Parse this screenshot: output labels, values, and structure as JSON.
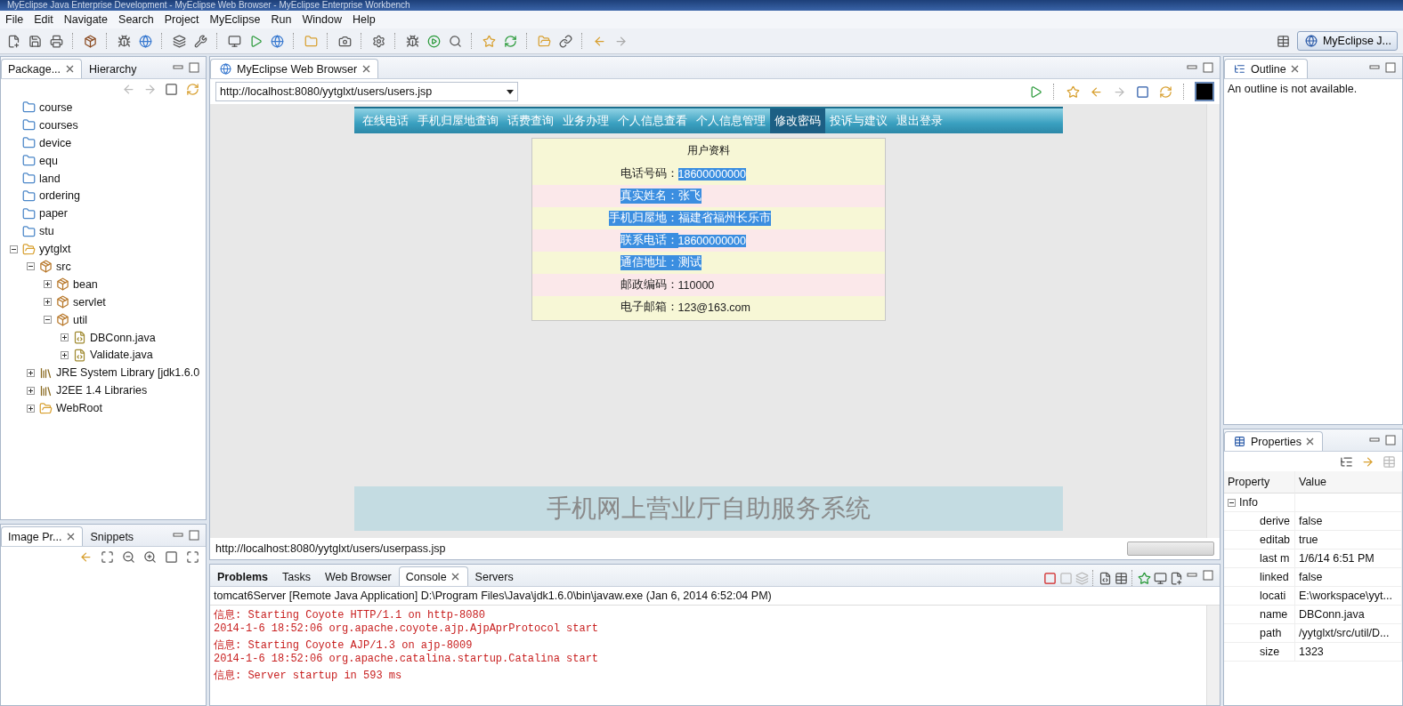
{
  "window": {
    "title": "MyEclipse Java Enterprise Development - MyEclipse Web Browser - MyEclipse Enterprise Workbench"
  },
  "menu": [
    "File",
    "Edit",
    "Navigate",
    "Search",
    "Project",
    "MyEclipse",
    "Run",
    "Window",
    "Help"
  ],
  "perspective": {
    "label": "MyEclipse J..."
  },
  "package_explorer": {
    "tabs": [
      {
        "label": "Package...",
        "selected": true
      },
      {
        "label": "Hierarchy",
        "selected": false
      }
    ],
    "tree": [
      {
        "label": "course",
        "kind": "folder"
      },
      {
        "label": "courses",
        "kind": "folder"
      },
      {
        "label": "device",
        "kind": "folder"
      },
      {
        "label": "equ",
        "kind": "folder"
      },
      {
        "label": "land",
        "kind": "folder"
      },
      {
        "label": "ordering",
        "kind": "folder"
      },
      {
        "label": "paper",
        "kind": "folder"
      },
      {
        "label": "stu",
        "kind": "folder"
      },
      {
        "label": "yytglxt",
        "kind": "project",
        "expanded": true,
        "children": [
          {
            "label": "src",
            "kind": "source",
            "expanded": true,
            "children": [
              {
                "label": "bean",
                "kind": "package",
                "expanded": false
              },
              {
                "label": "servlet",
                "kind": "package",
                "expanded": false
              },
              {
                "label": "util",
                "kind": "package",
                "expanded": true,
                "children": [
                  {
                    "label": "DBConn.java",
                    "kind": "java",
                    "expanded": false
                  },
                  {
                    "label": "Validate.java",
                    "kind": "java",
                    "expanded": false
                  }
                ]
              }
            ]
          },
          {
            "label": "JRE System Library [jdk1.6.0",
            "kind": "library",
            "expanded": false
          },
          {
            "label": "J2EE 1.4 Libraries",
            "kind": "library",
            "expanded": false
          },
          {
            "label": "WebRoot",
            "kind": "webfolder",
            "expanded": false
          }
        ]
      }
    ]
  },
  "image_preview": {
    "tabs": [
      {
        "label": "Image Pr...",
        "selected": true
      },
      {
        "label": "Snippets",
        "selected": false
      }
    ]
  },
  "browser": {
    "tab": "MyEclipse Web Browser",
    "url": "http://localhost:8080/yytglxt/users/users.jsp",
    "status": "http://localhost:8080/yytglxt/users/userpass.jsp",
    "page": {
      "nav": [
        {
          "label": "在线电话",
          "selected": false
        },
        {
          "label": "手机归屋地查询",
          "selected": false
        },
        {
          "label": "话费查询",
          "selected": false
        },
        {
          "label": "业务办理",
          "selected": false
        },
        {
          "label": "个人信息查看",
          "selected": false
        },
        {
          "label": "个人信息管理",
          "selected": false
        },
        {
          "label": "修改密码",
          "selected": true
        },
        {
          "label": "投诉与建议",
          "selected": false
        },
        {
          "label": "退出登录",
          "selected": false
        }
      ],
      "form_title": "用户资料",
      "fields": [
        {
          "label": {
            "text": "电话号码：",
            "selected": false
          },
          "value": {
            "text": "18600000000",
            "selected": true
          }
        },
        {
          "label": {
            "text": "真实姓名：",
            "selected": true
          },
          "value": {
            "text": "张飞",
            "selected": true
          }
        },
        {
          "label": {
            "text": "手机归屋地：",
            "selected": true
          },
          "value": {
            "text": "福建省福州长乐市",
            "selected": true
          }
        },
        {
          "label": {
            "text": "联系电话：",
            "selected": true
          },
          "value": {
            "text": "18600000000",
            "selected": true
          }
        },
        {
          "label": {
            "text": "通信地址：",
            "selected": true
          },
          "value": {
            "text": "测试",
            "selected": true
          }
        },
        {
          "label": {
            "text": "邮政编码：",
            "selected": false
          },
          "value": {
            "text": "110000",
            "selected": false
          }
        },
        {
          "label": {
            "text": "电子邮箱：",
            "selected": false
          },
          "value": {
            "text": "123@163.com",
            "selected": false
          }
        }
      ],
      "footer": "手机网上营业厅自助服务系统"
    }
  },
  "console": {
    "tabs": [
      {
        "label": "Problems",
        "selected": false,
        "bold": true
      },
      {
        "label": "Tasks",
        "selected": false,
        "bold": false
      },
      {
        "label": "Web Browser",
        "selected": false,
        "bold": false
      },
      {
        "label": "Console",
        "selected": true,
        "bold": false
      },
      {
        "label": "Servers",
        "selected": false,
        "bold": false
      }
    ],
    "process": "tomcat6Server [Remote Java Application] D:\\Program Files\\Java\\jdk1.6.0\\bin\\javaw.exe (Jan 6, 2014 6:52:04 PM)",
    "lines": [
      "信息: Starting Coyote HTTP/1.1 on http-8080",
      "2014-1-6 18:52:06 org.apache.coyote.ajp.AjpAprProtocol start",
      "信息: Starting Coyote AJP/1.3 on ajp-8009",
      "2014-1-6 18:52:06 org.apache.catalina.startup.Catalina start",
      "信息: Server startup in 593 ms"
    ]
  },
  "outline": {
    "tab": "Outline",
    "message": "An outline is not available."
  },
  "properties": {
    "tab": "Properties",
    "columns": [
      "Property",
      "Value"
    ],
    "group": {
      "label": "Info",
      "expanded": true
    },
    "rows": [
      {
        "name": "derive",
        "value": "false"
      },
      {
        "name": "editab",
        "value": "true"
      },
      {
        "name": "last m",
        "value": "1/6/14 6:51 PM"
      },
      {
        "name": "linked",
        "value": "false"
      },
      {
        "name": "locati",
        "value": "E:\\workspace\\yyt..."
      },
      {
        "name": "name",
        "value": "DBConn.java"
      },
      {
        "name": "path",
        "value": "/yytglxt/src/util/D..."
      },
      {
        "name": "size",
        "value": "1323"
      }
    ]
  }
}
